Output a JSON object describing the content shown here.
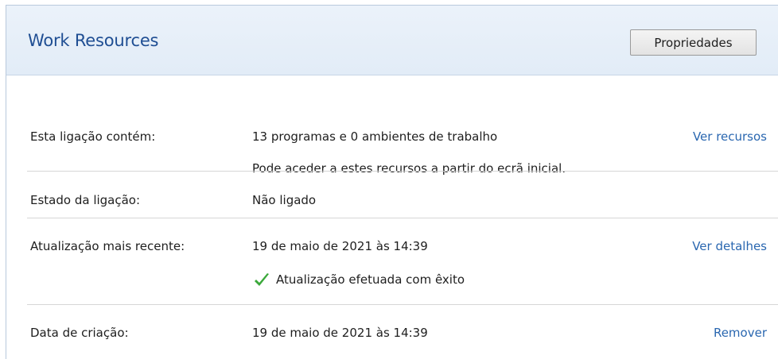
{
  "header": {
    "title": "Work Resources",
    "properties_button": "Propriedades"
  },
  "rows": {
    "contents": {
      "label": "Esta ligação contém:",
      "value": "13 programas e 0 ambientes de trabalho",
      "note": "Pode aceder a estes recursos a partir do ecrã inicial.",
      "link": "Ver recursos"
    },
    "status": {
      "label": "Estado da ligação:",
      "value": "Não ligado"
    },
    "last_update": {
      "label": "Atualização mais recente:",
      "value": "19 de maio de 2021 às 14:39",
      "result": "Atualização efetuada com êxito",
      "result_icon": "checkmark-icon",
      "result_color": "#3aa83a",
      "link": "Ver detalhes"
    },
    "created": {
      "label": "Data de criação:",
      "value": "19 de maio de 2021 às 14:39",
      "link": "Remover"
    }
  },
  "colors": {
    "title": "#1f4e93",
    "link": "#2a67b0",
    "header_bg": "#e6eef8"
  }
}
